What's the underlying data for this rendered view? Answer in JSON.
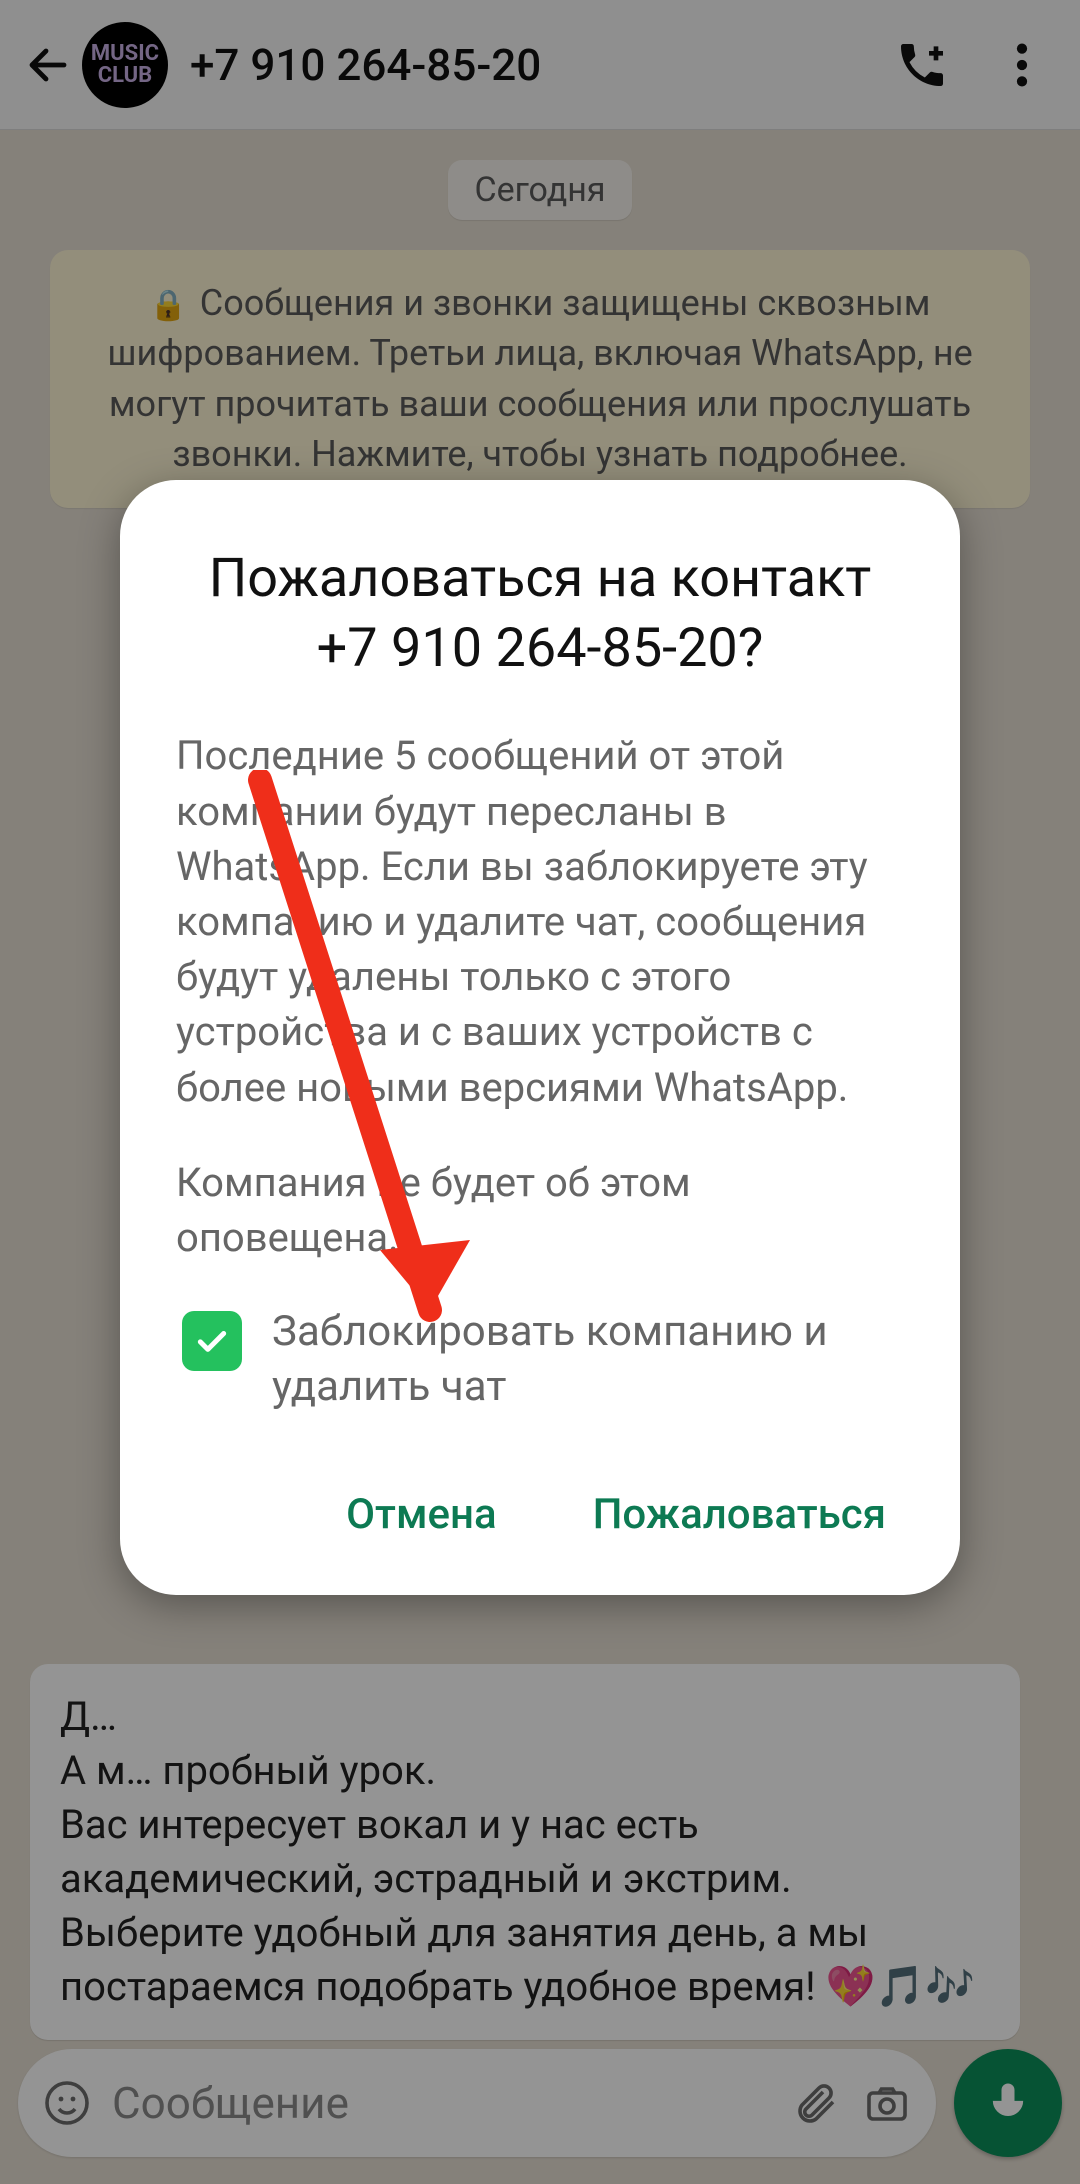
{
  "header": {
    "contact_name": "+7 910 264-85-20",
    "avatar_text": "MUSIC\nCLUB"
  },
  "chat": {
    "date_label": "Сегодня",
    "encryption_notice": "Сообщения и звонки защищены сквозным шифрованием. Третьи лица, включая WhatsApp, не могут прочитать ваши сообщения или прослушать звонки. Нажмите, чтобы узнать подробнее.",
    "incoming_message": "Д…\nА м…                       пробный урок.\nВас интересует вокал и у нас есть академический, эстрадный и экстрим.\nВыберите удобный для занятия день, а мы постараемся подобрать удобное время! 💖🎵🎶"
  },
  "input": {
    "placeholder": "Сообщение"
  },
  "dialog": {
    "title": "Пожаловаться на контакт +7 910 264-85-20?",
    "body_p1": "Последние 5 сообщений от этой компании будут пересланы в WhatsApp. Если вы заблокируете эту компанию и удалите чат, сообщения будут удалены только с этого устройства и с ваших устройств с более новыми версиями WhatsApp.",
    "body_p2": "Компания не будет об этом оповещена.",
    "checkbox_label": "Заблокировать компанию и удалить чат",
    "cancel": "Отмена",
    "confirm": "Пожаловаться"
  },
  "colors": {
    "accent_green": "#0d7a53",
    "checkbox_green": "#24c15e",
    "mic_green": "#0b8f5a",
    "arrow_red": "#ef2e1a"
  }
}
